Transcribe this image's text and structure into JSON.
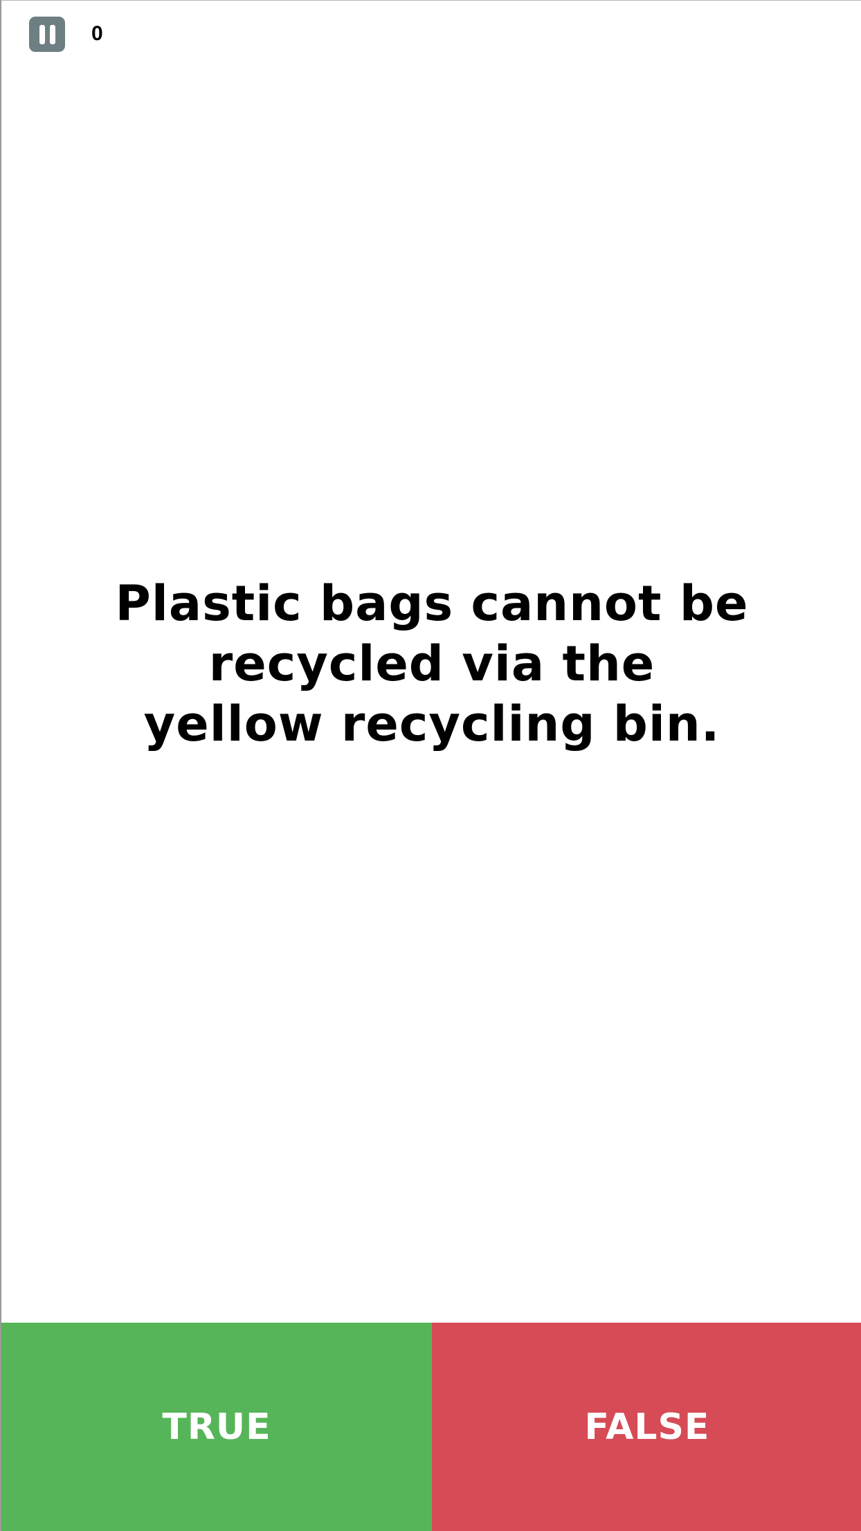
{
  "hud": {
    "score": "0",
    "pause_icon": "pause-icon"
  },
  "question": {
    "text": "Plastic bags cannot be recycled via the yellow recycling bin."
  },
  "answers": {
    "true_label": "TRUE",
    "false_label": "FALSE"
  },
  "colors": {
    "true_button": "#56b558",
    "false_button": "#d64b55",
    "pause_button": "#6d7f82"
  }
}
